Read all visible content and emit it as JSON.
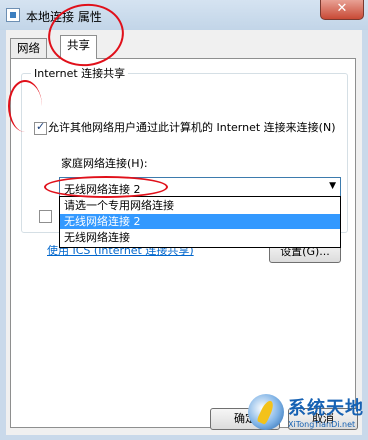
{
  "window": {
    "title": "本地连接 属性",
    "close_symbol": "✕"
  },
  "tabs": [
    {
      "label": "网络"
    },
    {
      "label": "共享"
    }
  ],
  "sharing": {
    "group_title": "Internet 连接共享",
    "allow_share_label": "允许其他网络用户通过此计算机的 Internet 连接来连接(N)",
    "allow_share_checked": true,
    "home_network_label": "家庭网络连接(H):",
    "home_network_value": "无线网络连接 2",
    "dropdown_options": [
      "请选一个专用网络连接",
      "无线网络连接 2",
      "无线网络连接"
    ],
    "dropdown_selected_index": 1,
    "second_checkbox_checked": false,
    "ics_link": "使用 ICS (Internet 连接共享)",
    "settings_button": "设置(G)..."
  },
  "dialog_buttons": {
    "ok": "确定",
    "cancel": "取消"
  },
  "watermark": {
    "name": "系统天地",
    "url": "XiTongTianDi.net"
  },
  "colors": {
    "accent": "#3399ff",
    "annotation": "#e0101a",
    "link": "#0066cc"
  }
}
